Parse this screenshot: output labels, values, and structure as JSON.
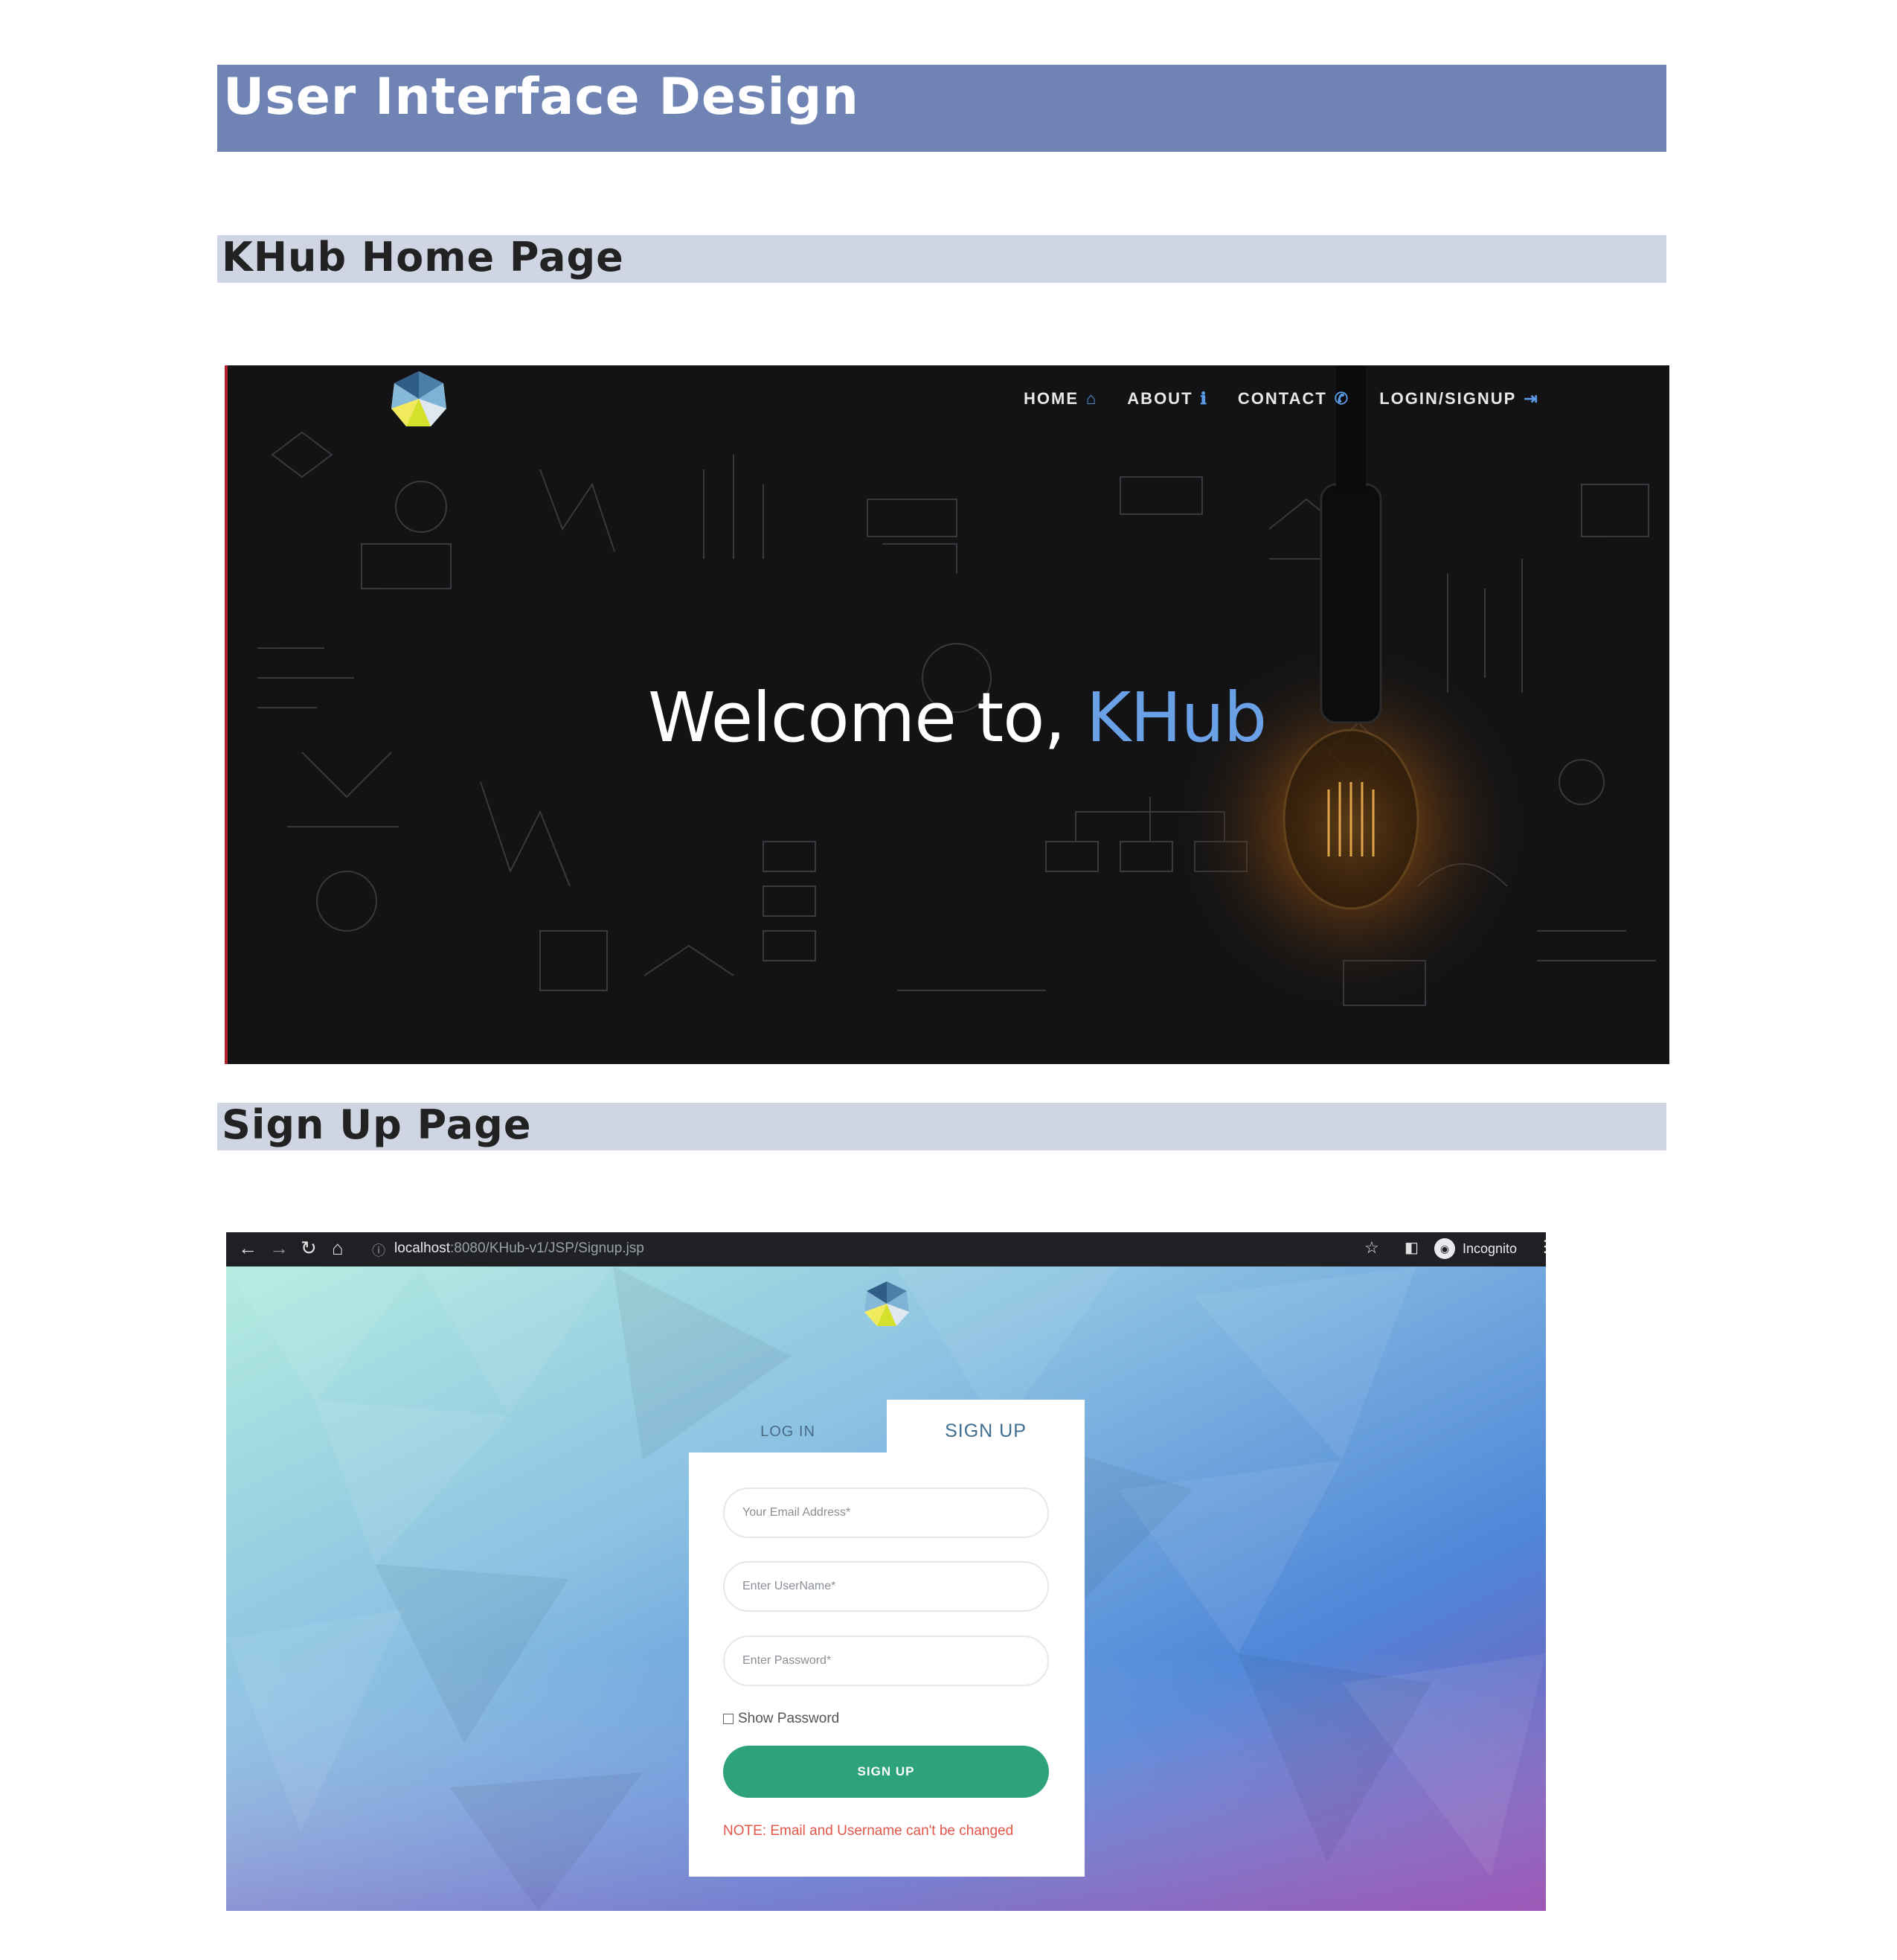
{
  "headings": {
    "main": "User Interface Design",
    "home_section": "KHub Home Page",
    "signup_section": "Sign Up Page"
  },
  "home": {
    "nav": [
      {
        "label": "HOME",
        "icon": "home-icon",
        "glyph": "⌂"
      },
      {
        "label": "ABOUT",
        "icon": "info-icon",
        "glyph": "ℹ"
      },
      {
        "label": "CONTACT",
        "icon": "phone-icon",
        "glyph": "✆"
      },
      {
        "label": "LOGIN/SIGNUP",
        "icon": "login-icon",
        "glyph": "⇥"
      }
    ],
    "welcome_prefix": "Welcome to,",
    "welcome_brand": "KHub",
    "accent_color": "#6aa0e6"
  },
  "signup": {
    "browser": {
      "url_host": "localhost",
      "url_path": ":8080/KHub-v1/JSP/Signup.jsp",
      "incognito_label": "Incognito"
    },
    "tabs": {
      "login": "LOG IN",
      "signup": "SIGN UP"
    },
    "fields": {
      "email_placeholder": "Your Email Address*",
      "username_placeholder": "Enter UserName*",
      "password_placeholder": "Enter Password*"
    },
    "show_password_label": "Show Password",
    "submit_label": "SIGN UP",
    "note": "NOTE: Email and Username can't be changed",
    "button_color": "#2ea279",
    "note_color": "#e0574a"
  }
}
